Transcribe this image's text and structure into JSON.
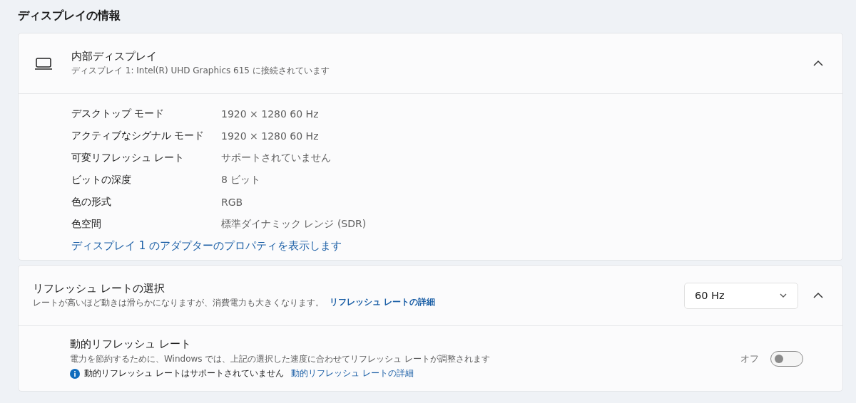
{
  "heading": "ディスプレイの情報",
  "display_card": {
    "title": "内部ディスプレイ",
    "subtitle": "ディスプレイ 1: Intel(R) UHD Graphics 615 に接続されています",
    "expanded": true,
    "properties": [
      {
        "label": "デスクトップ モード",
        "value": "1920 × 1280 60 Hz"
      },
      {
        "label": "アクティブなシグナル モード",
        "value": "1920 × 1280 60 Hz"
      },
      {
        "label": "可変リフレッシュ レート",
        "value": "サポートされていません"
      },
      {
        "label": "ビットの深度",
        "value": "8 ビット"
      },
      {
        "label": "色の形式",
        "value": "RGB"
      },
      {
        "label": "色空間",
        "value": "標準ダイナミック レンジ (SDR)"
      }
    ],
    "link": "ディスプレイ 1 のアダプターのプロパティを表示します"
  },
  "refresh_card": {
    "title": "リフレッシュ レートの選択",
    "description": "レートが高いほど動きは滑らかになりますが、消費電力も大きくなります。",
    "link": "リフレッシュ レートの詳細",
    "dropdown": {
      "value": "60 Hz"
    },
    "expanded": true,
    "dynamic": {
      "title": "動的リフレッシュ レート",
      "description": "電力を節約するために、Windows では、上記の選択した速度に合わせてリフレッシュ レートが調整されます",
      "info": "動的リフレッシュ レートはサポートされていません",
      "link": "動的リフレッシュ レートの詳細",
      "toggle_label": "オフ",
      "on": false
    }
  }
}
